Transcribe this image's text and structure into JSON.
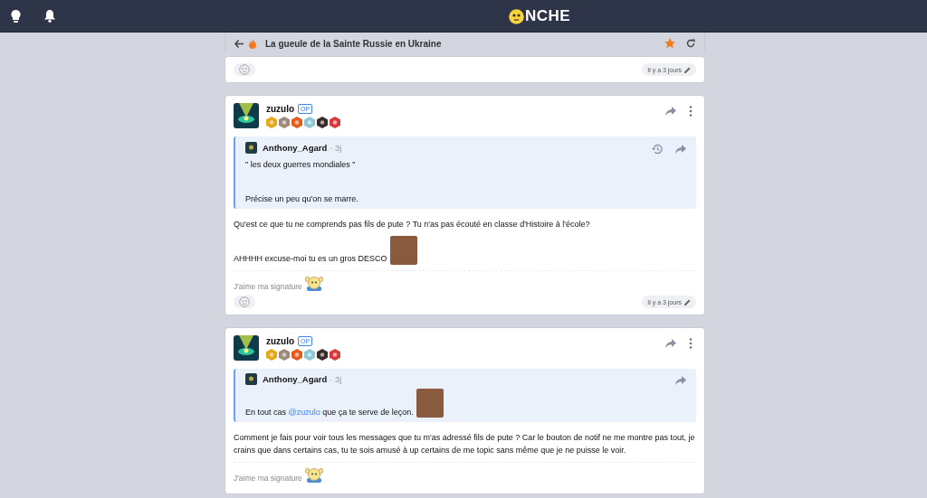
{
  "header": {
    "logo_text": "NCHE"
  },
  "topic": {
    "title": "La gueule de la Sainte Russie en Ukraine",
    "favorite": true
  },
  "previous_post_footer": {
    "time": "Il y a 3 jours"
  },
  "posts": [
    {
      "author": "zuzulo",
      "op_label": "OP",
      "quote": {
        "author": "Anthony_Agard",
        "age": "· 3j",
        "history": true,
        "paragraphs": [
          {
            "parts": [
              {
                "text": "\" les deux guerres mondiales \""
              }
            ],
            "image": false
          },
          {
            "parts": [
              {
                "text": "Précise un peu qu'on se marre."
              }
            ],
            "image": false
          }
        ]
      },
      "paragraphs": [
        {
          "parts": [
            {
              "text": "Qu'est ce que tu ne comprends pas fils de pute ? Tu n'as pas écouté en classe d'Histoire à l'école?"
            }
          ],
          "image": false
        },
        {
          "parts": [
            {
              "text": "AHHHH excuse-moi tu es un gros DESCO"
            }
          ],
          "image": true
        }
      ],
      "signature": "J'aime ma signature",
      "time": "Il y a 3 jours"
    },
    {
      "author": "zuzulo",
      "op_label": "OP",
      "quote": {
        "author": "Anthony_Agard",
        "age": "· 3j",
        "history": false,
        "paragraphs": [
          {
            "parts": [
              {
                "text": "En tout cas "
              },
              {
                "mention": "@zuzulo"
              },
              {
                "text": " que ça te serve de leçon."
              }
            ],
            "image": true
          }
        ]
      },
      "paragraphs": [
        {
          "parts": [
            {
              "text": "Comment je fais pour voir tous les messages que tu m'as adressé fils de pute ? Car le bouton de notif ne me montre pas tout, je crains que dans certains cas, tu te sois amusé à up certains de me topic sans même que je ne puisse le voir."
            }
          ],
          "image": false
        }
      ],
      "signature": "J'aime ma signature"
    }
  ]
}
